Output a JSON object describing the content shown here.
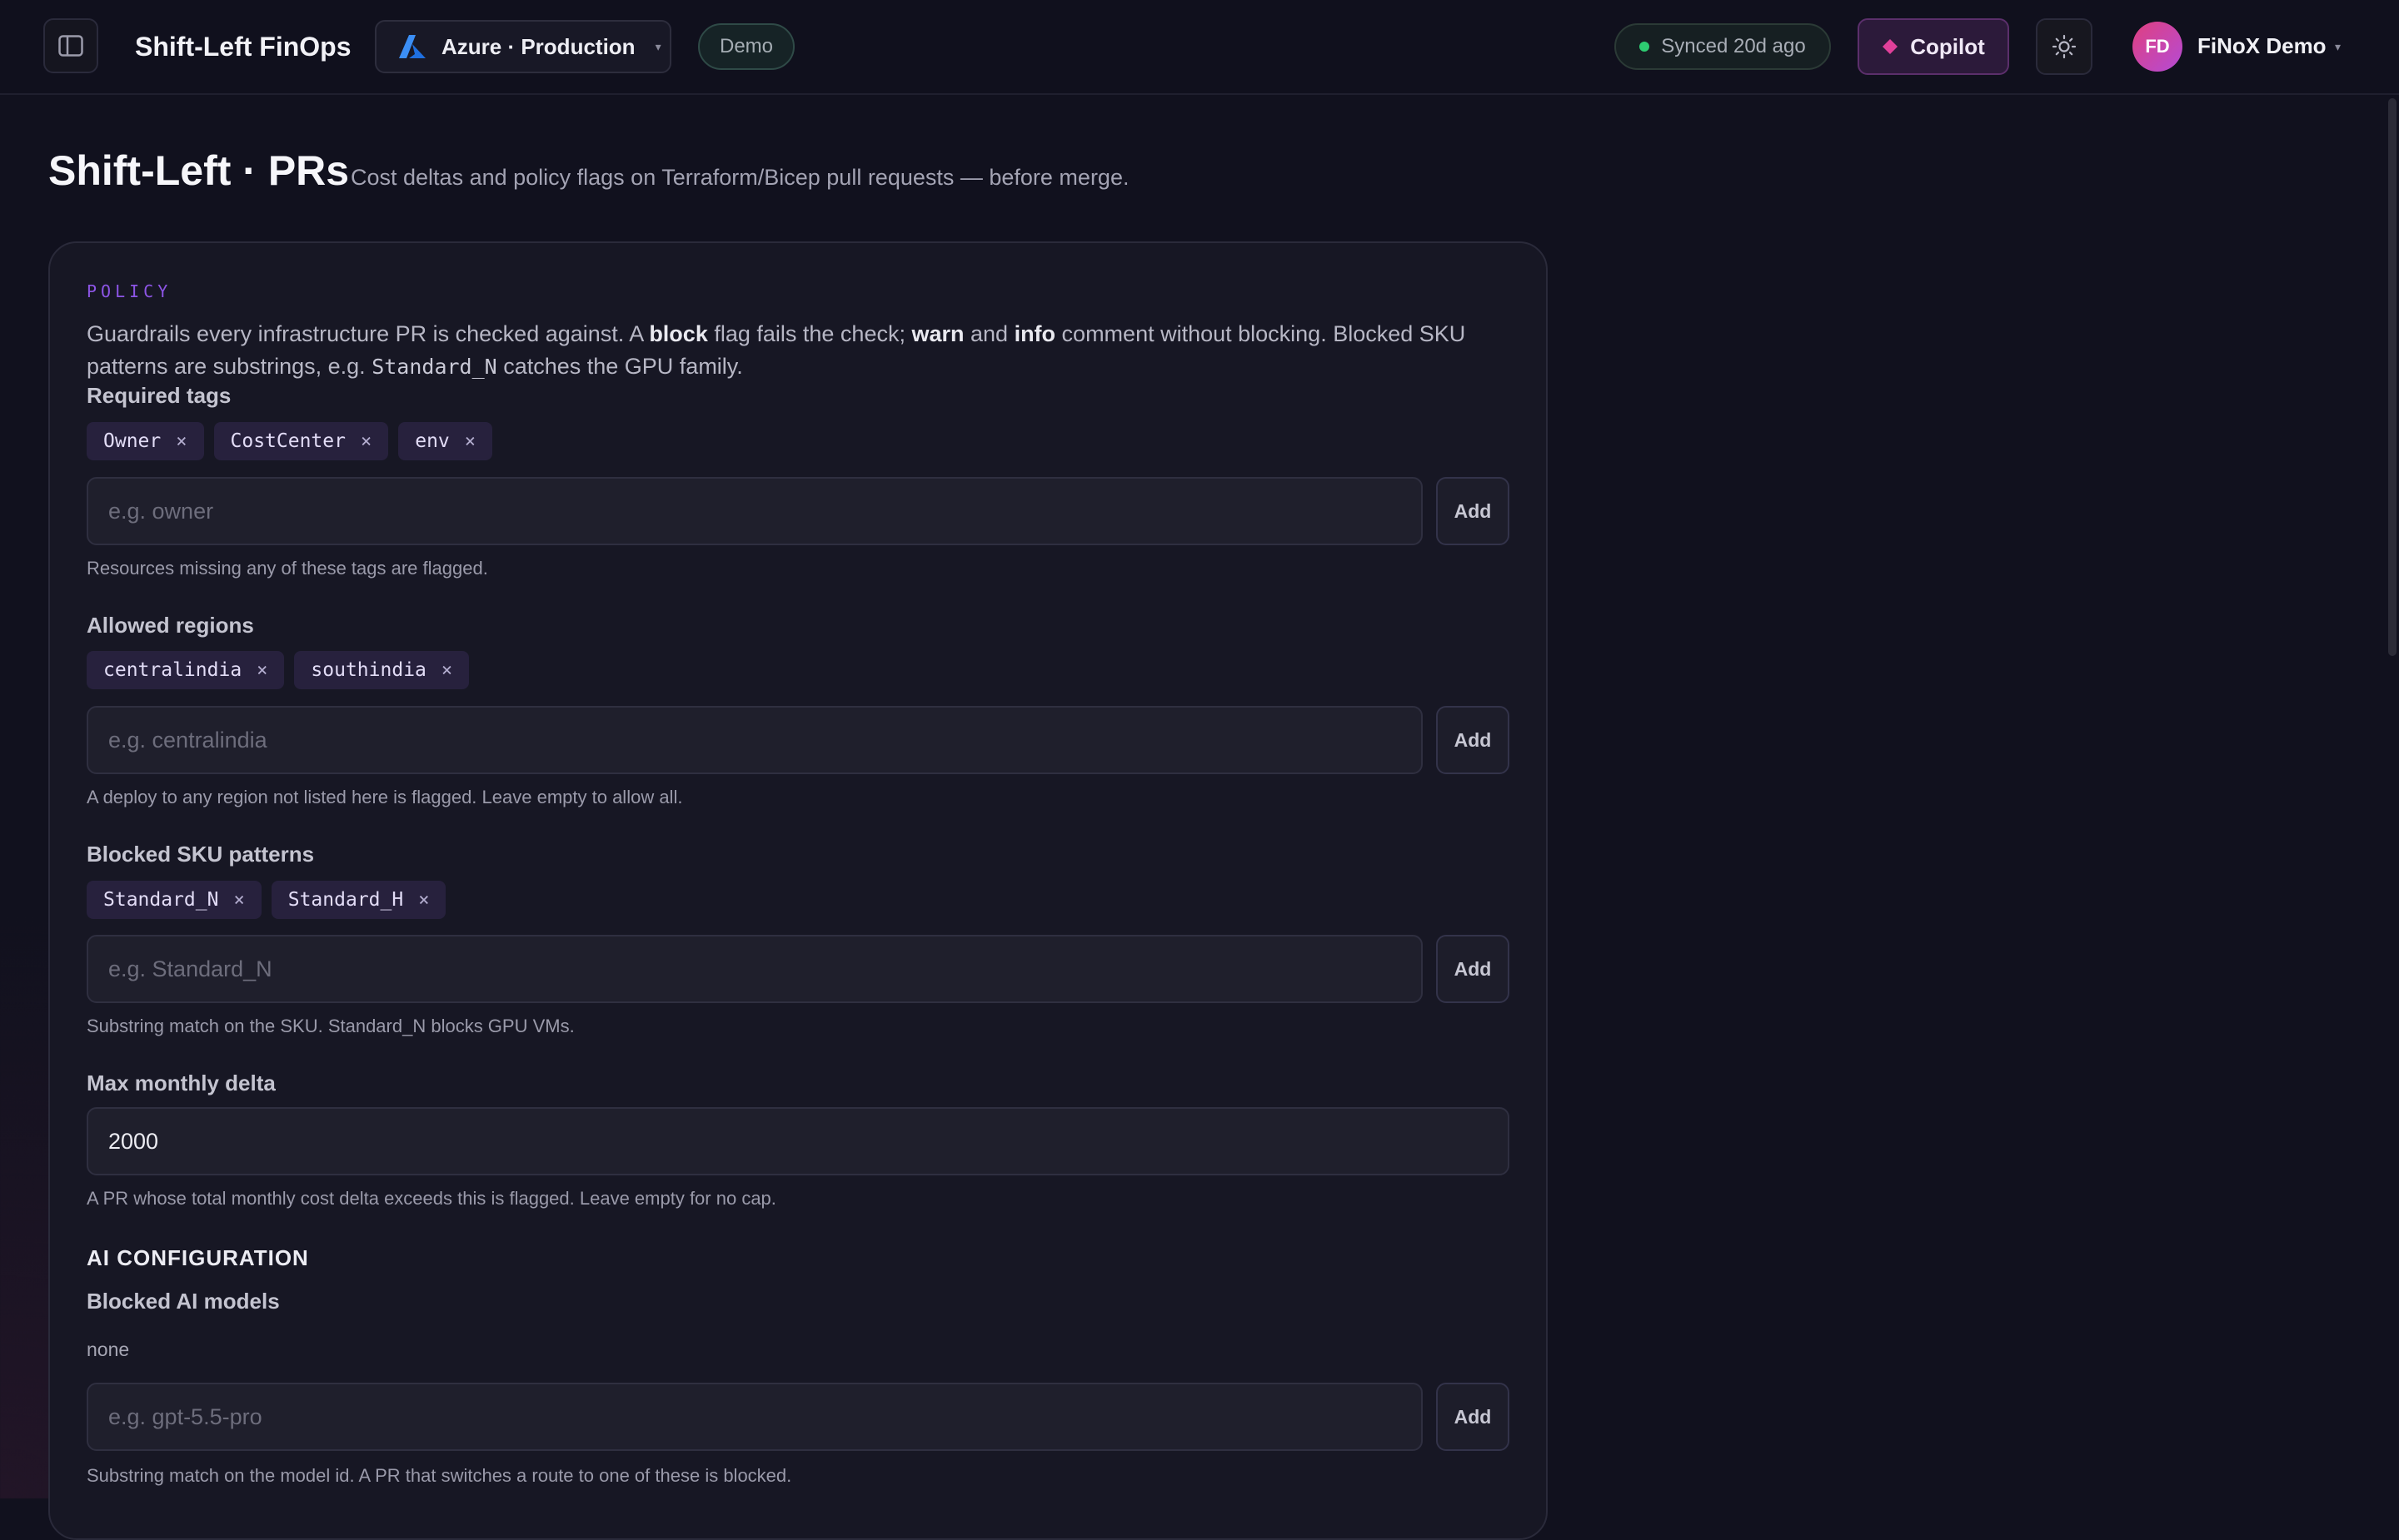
{
  "topbar": {
    "app_title": "Shift-Left FinOps",
    "environment": "Azure · Production",
    "demo_badge": "Demo",
    "sync_status": "Synced 20d ago",
    "copilot_label": "Copilot",
    "user_initials": "FD",
    "user_name": "FiNoX Demo"
  },
  "page": {
    "title": "Shift-Left · PRs",
    "subtitle": "Cost deltas and policy flags on Terraform/Bicep pull requests — before merge."
  },
  "policy": {
    "eyebrow": "POLICY",
    "desc_1": "Guardrails every infrastructure PR is checked against. A ",
    "desc_block": "block",
    "desc_2": " flag fails the check; ",
    "desc_warn": "warn",
    "desc_3": " and ",
    "desc_info": "info",
    "desc_4": " comment without blocking. Blocked SKU patterns are substrings, e.g. ",
    "desc_code": "Standard_N",
    "desc_5": " catches the GPU family.",
    "add_label": "Add",
    "required_tags": {
      "label": "Required tags",
      "chips": [
        "Owner",
        "CostCenter",
        "env"
      ],
      "placeholder": "e.g. owner",
      "help": "Resources missing any of these tags are flagged."
    },
    "allowed_regions": {
      "label": "Allowed regions",
      "chips": [
        "centralindia",
        "southindia"
      ],
      "placeholder": "e.g. centralindia",
      "help": "A deploy to any region not listed here is flagged. Leave empty to allow all."
    },
    "blocked_skus": {
      "label": "Blocked SKU patterns",
      "chips": [
        "Standard_N",
        "Standard_H"
      ],
      "placeholder": "e.g. Standard_N",
      "help": "Substring match on the SKU. Standard_N blocks GPU VMs."
    },
    "max_delta": {
      "label": "Max monthly delta",
      "value": "2000",
      "help": "A PR whose total monthly cost delta exceeds this is flagged. Leave empty for no cap."
    },
    "ai_section": "AI CONFIGURATION",
    "blocked_ai": {
      "label": "Blocked AI models",
      "empty_text": "none",
      "placeholder": "e.g. gpt-5.5-pro",
      "help": "Substring match on the model id. A PR that switches a route to one of these is blocked."
    }
  },
  "colors": {
    "background": "#11111e",
    "card": "#171724",
    "accent_purple": "#8d55e6",
    "chip_bg": "#27213d",
    "sync_green": "#2ecc71",
    "azure_blue": "#2f8bff",
    "copilot_pink": "#e0409a"
  },
  "icons": [
    "sidebar-toggle-icon",
    "azure-logo-icon",
    "chevron-down-icon",
    "status-dot-icon",
    "copilot-diamond-icon",
    "sun-icon",
    "close-icon"
  ]
}
